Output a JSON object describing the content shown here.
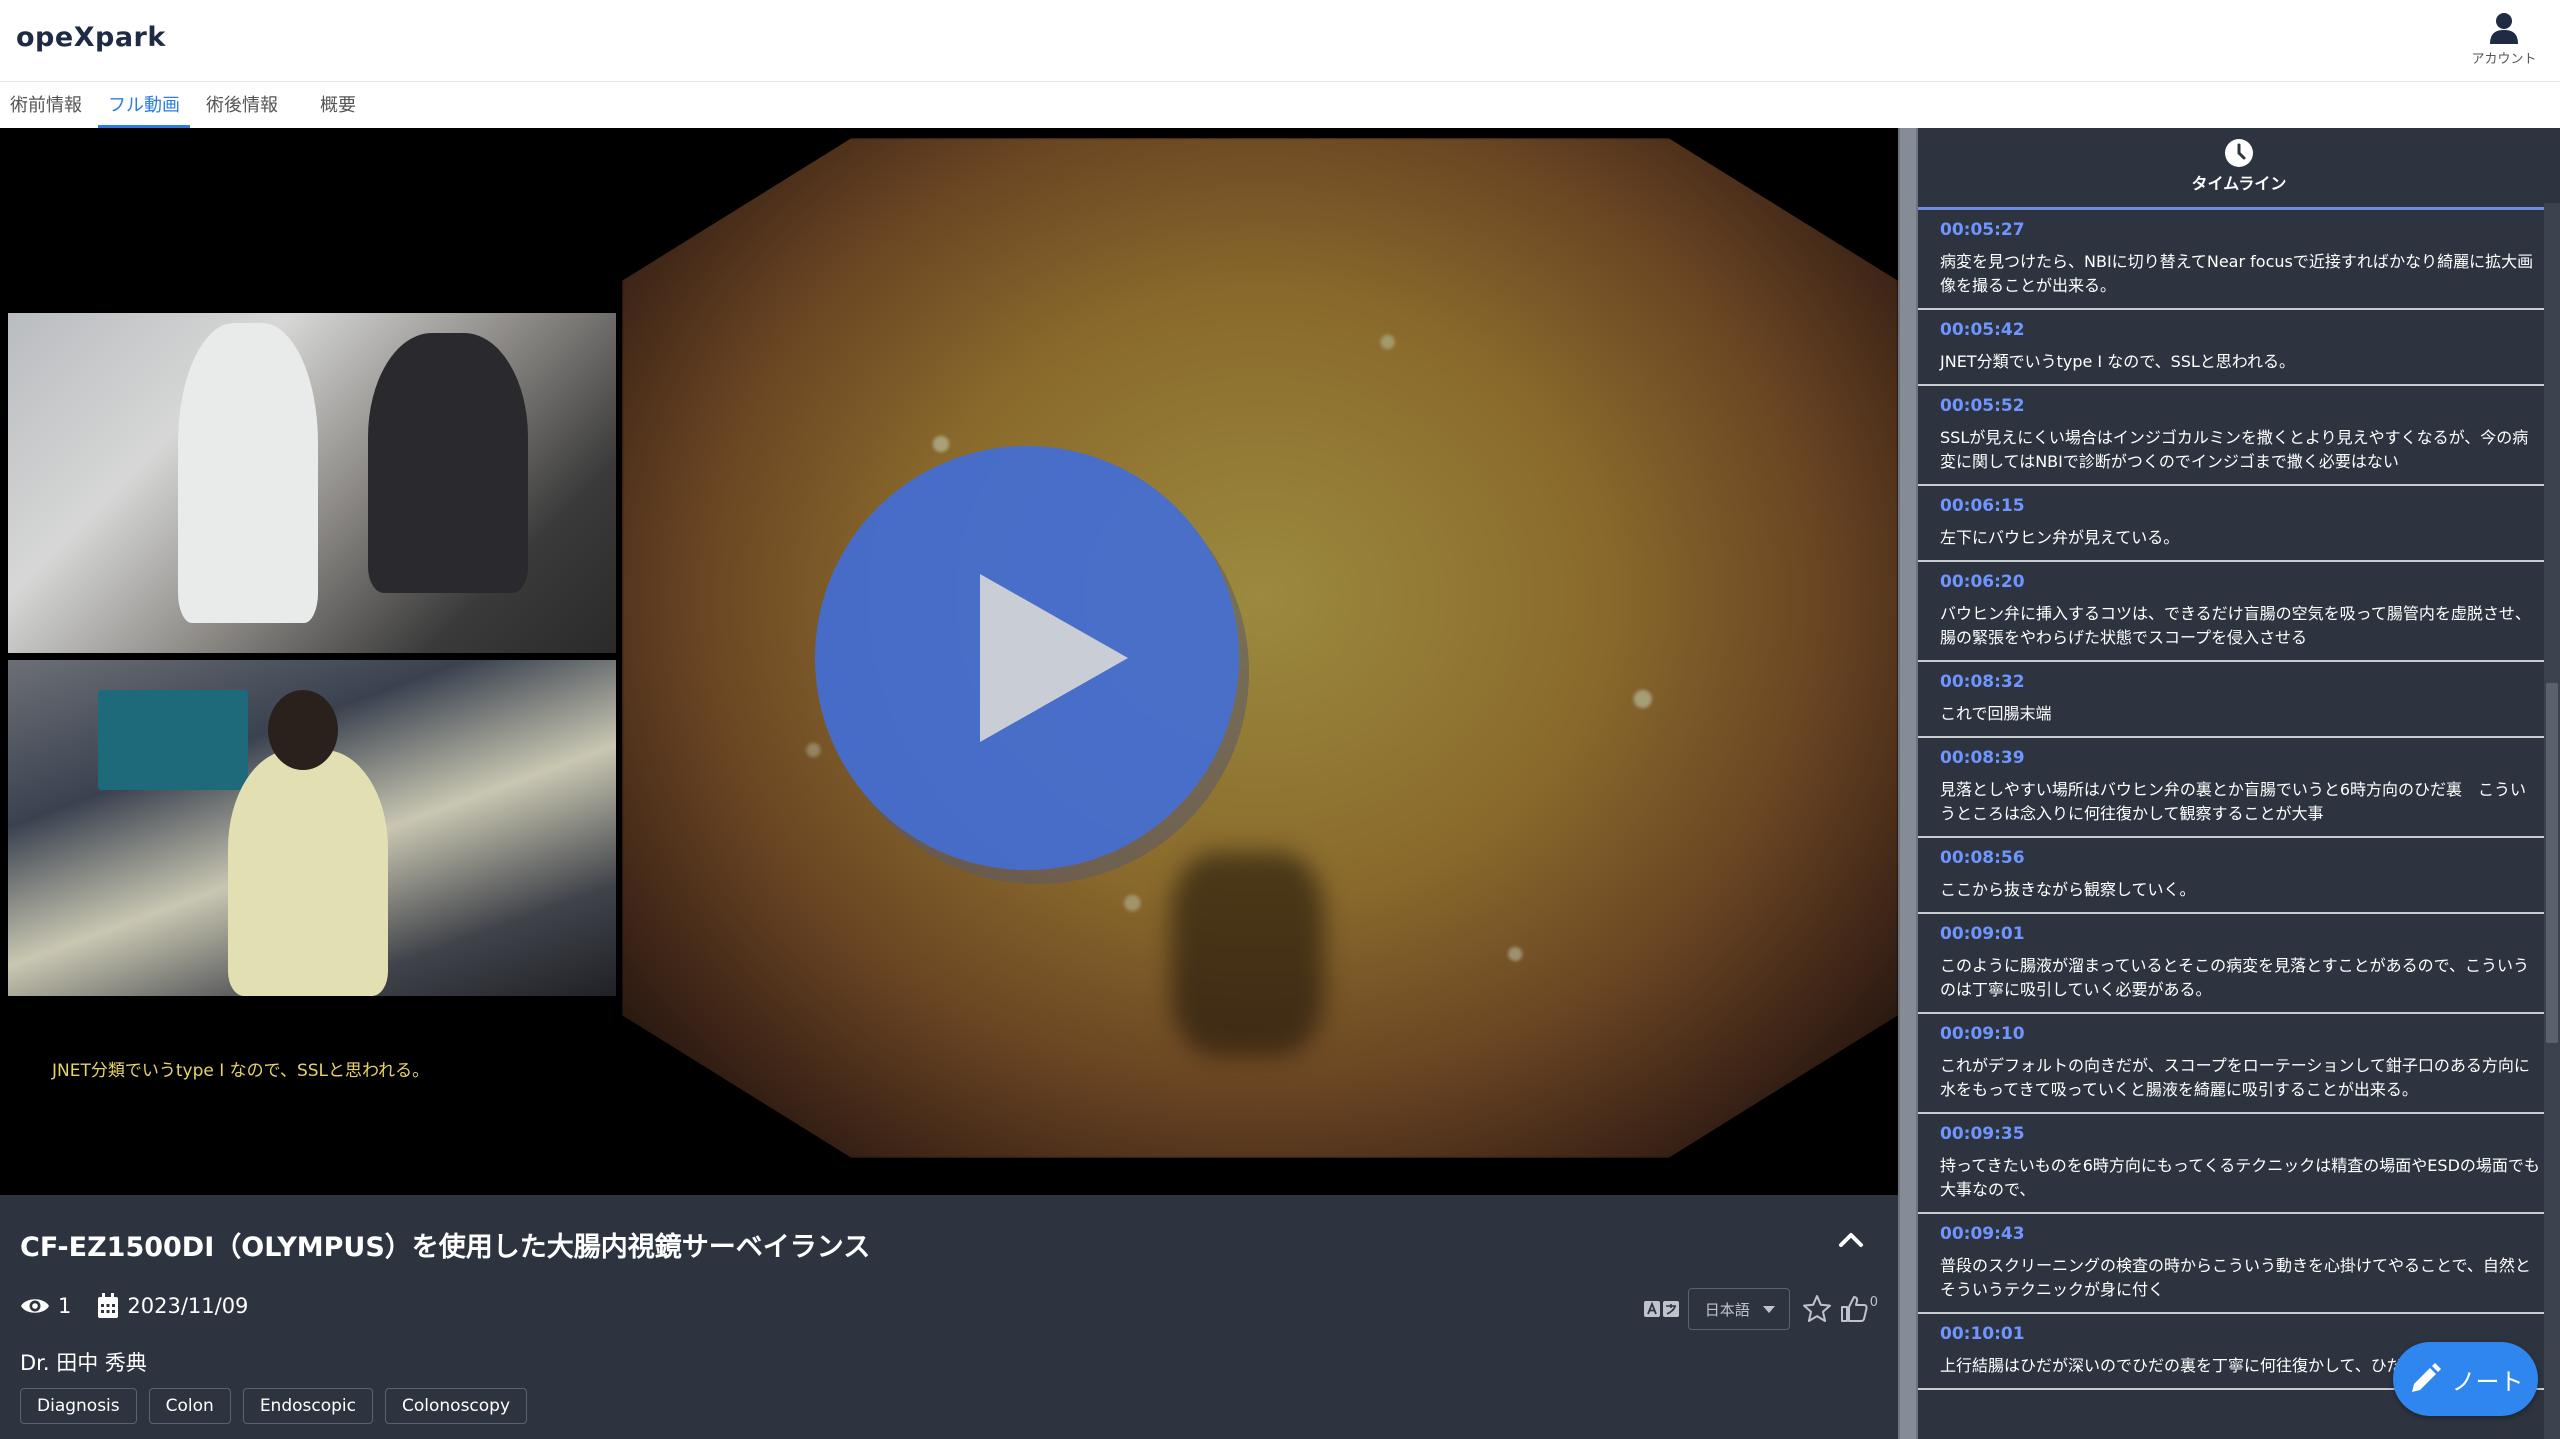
{
  "app": {
    "logo": "opeXpark"
  },
  "header": {
    "account_label": "アカウント",
    "account_icon": "person-icon"
  },
  "tabs": [
    {
      "label": "術前情報",
      "active": false
    },
    {
      "label": "フル動画",
      "active": true
    },
    {
      "label": "術後情報",
      "active": false
    },
    {
      "label": "概要",
      "active": false
    }
  ],
  "player": {
    "subtitle": "JNET分類でいうtype I なので、SSLと思われる。",
    "play_icon": "play-icon"
  },
  "video": {
    "title": "CF-EZ1500DI（OLYMPUS）を使用した大腸内視鏡サーベイランス",
    "views": "1",
    "date": "2023/11/09",
    "doctor": "Dr. 田中 秀典",
    "tags": [
      "Diagnosis",
      "Colon",
      "Endoscopic",
      "Colonoscopy"
    ],
    "language": "日本語",
    "likes": "0"
  },
  "timeline": {
    "label": "タイムライン",
    "entries": [
      {
        "time": "00:05:27",
        "text": "病変を見つけたら、NBIに切り替えてNear focusで近接すればかなり綺麗に拡大画像を撮ることが出来る。"
      },
      {
        "time": "00:05:42",
        "text": "JNET分類でいうtype I なので、SSLと思われる。"
      },
      {
        "time": "00:05:52",
        "text": "SSLが見えにくい場合はインジゴカルミンを撒くとより見えやすくなるが、今の病変に関してはNBIで診断がつくのでインジゴまで撒く必要はない"
      },
      {
        "time": "00:06:15",
        "text": "左下にバウヒン弁が見えている。"
      },
      {
        "time": "00:06:20",
        "text": "バウヒン弁に挿入するコツは、できるだけ盲腸の空気を吸って腸管内を虚脱させ、腸の緊張をやわらげた状態でスコープを侵入させる"
      },
      {
        "time": "00:08:32",
        "text": "これで回腸末端"
      },
      {
        "time": "00:08:39",
        "text": "見落としやすい場所はバウヒン弁の裏とか盲腸でいうと6時方向のひだ裏　こういうところは念入りに何往復かして観察することが大事"
      },
      {
        "time": "00:08:56",
        "text": "ここから抜きながら観察していく。"
      },
      {
        "time": "00:09:01",
        "text": "このように腸液が溜まっているとそこの病変を見落とすことがあるので、こういうのは丁寧に吸引していく必要がある。"
      },
      {
        "time": "00:09:10",
        "text": "これがデフォルトの向きだが、スコープをローテーションして鉗子口のある方向に水をもってきて吸っていくと腸液を綺麗に吸引することが出来る。"
      },
      {
        "time": "00:09:35",
        "text": "持ってきたいものを6時方向にもってくるテクニックは精査の場面やESDの場面でも大事なので、"
      },
      {
        "time": "00:09:43",
        "text": "普段のスクリーニングの検査の時からこういう動きを心掛けてやることで、自然とそういうテクニックが身に付く"
      },
      {
        "time": "00:10:01",
        "text": "上行結腸はひだが深いのでひだの裏を丁寧に何往復かして、ひだの裏に見落とし"
      }
    ]
  },
  "note_button": {
    "label": "ノート",
    "icon": "pencil-icon"
  }
}
